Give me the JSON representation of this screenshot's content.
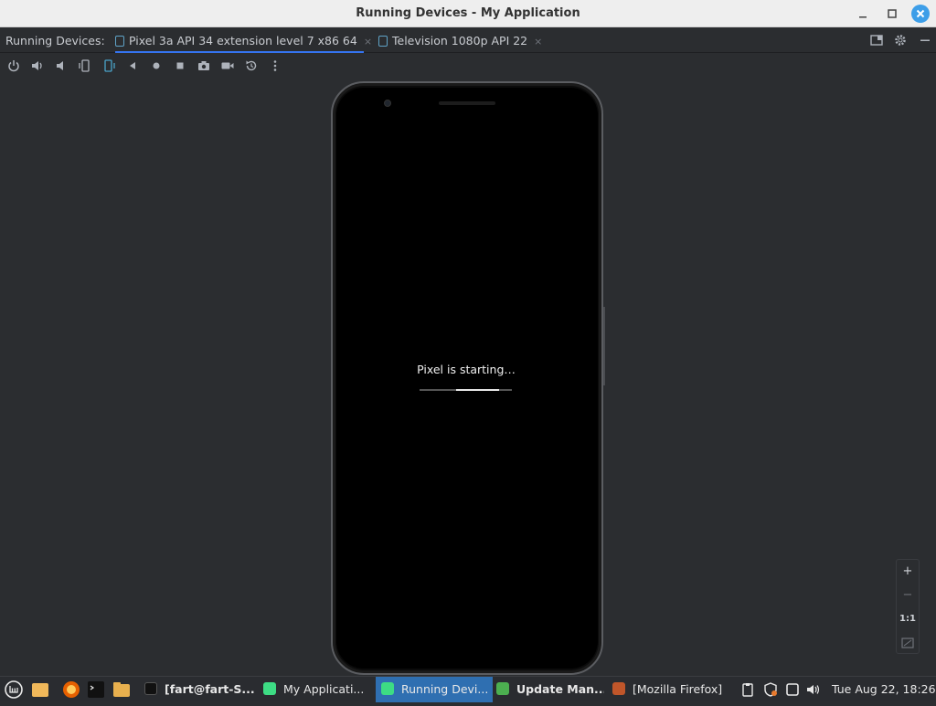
{
  "window": {
    "title": "Running Devices - My Application",
    "minimize_icon": "minimize-icon",
    "maximize_icon": "maximize-icon",
    "close_icon": "close-icon"
  },
  "tabbar": {
    "label": "Running Devices:",
    "tabs": [
      {
        "label": "Pixel 3a API 34 extension level 7 x86 64",
        "active": true
      },
      {
        "label": "Television 1080p API 22",
        "active": false
      }
    ],
    "close_glyph": "×"
  },
  "toolbar": {
    "tools": [
      "power-icon",
      "volume-up-icon",
      "volume-down-icon",
      "rotate-left-icon",
      "rotate-right-icon",
      "back-icon",
      "home-icon",
      "overview-icon",
      "screenshot-icon",
      "screen-record-icon",
      "snapshot-restore-icon",
      "more-options-icon"
    ]
  },
  "device": {
    "boot_message": "Pixel is starting…",
    "boot_progress": 0.47
  },
  "zoom": {
    "zoom_in": "+",
    "zoom_out": "−",
    "actual_size": "1:1",
    "fit_icon": "fit-screen-icon"
  },
  "taskbar": {
    "tasks": [
      {
        "label": "[fart@fart-S...",
        "icon": "terminal-icon"
      },
      {
        "label": "My Applicati...",
        "icon": "android-studio-icon"
      },
      {
        "label": "Running Devi...",
        "icon": "android-studio-icon",
        "active": true
      },
      {
        "label": "Update Man...",
        "icon": "update-manager-icon"
      },
      {
        "label": "[Mozilla Firefox]",
        "icon": "firefox-icon"
      }
    ],
    "clock": "Tue Aug 22, 18:26"
  },
  "colors": {
    "accent": "#3574f0",
    "background": "#2b2d30",
    "taskbar_active": "#2f6fb1",
    "close_button": "#3d9ee8"
  }
}
